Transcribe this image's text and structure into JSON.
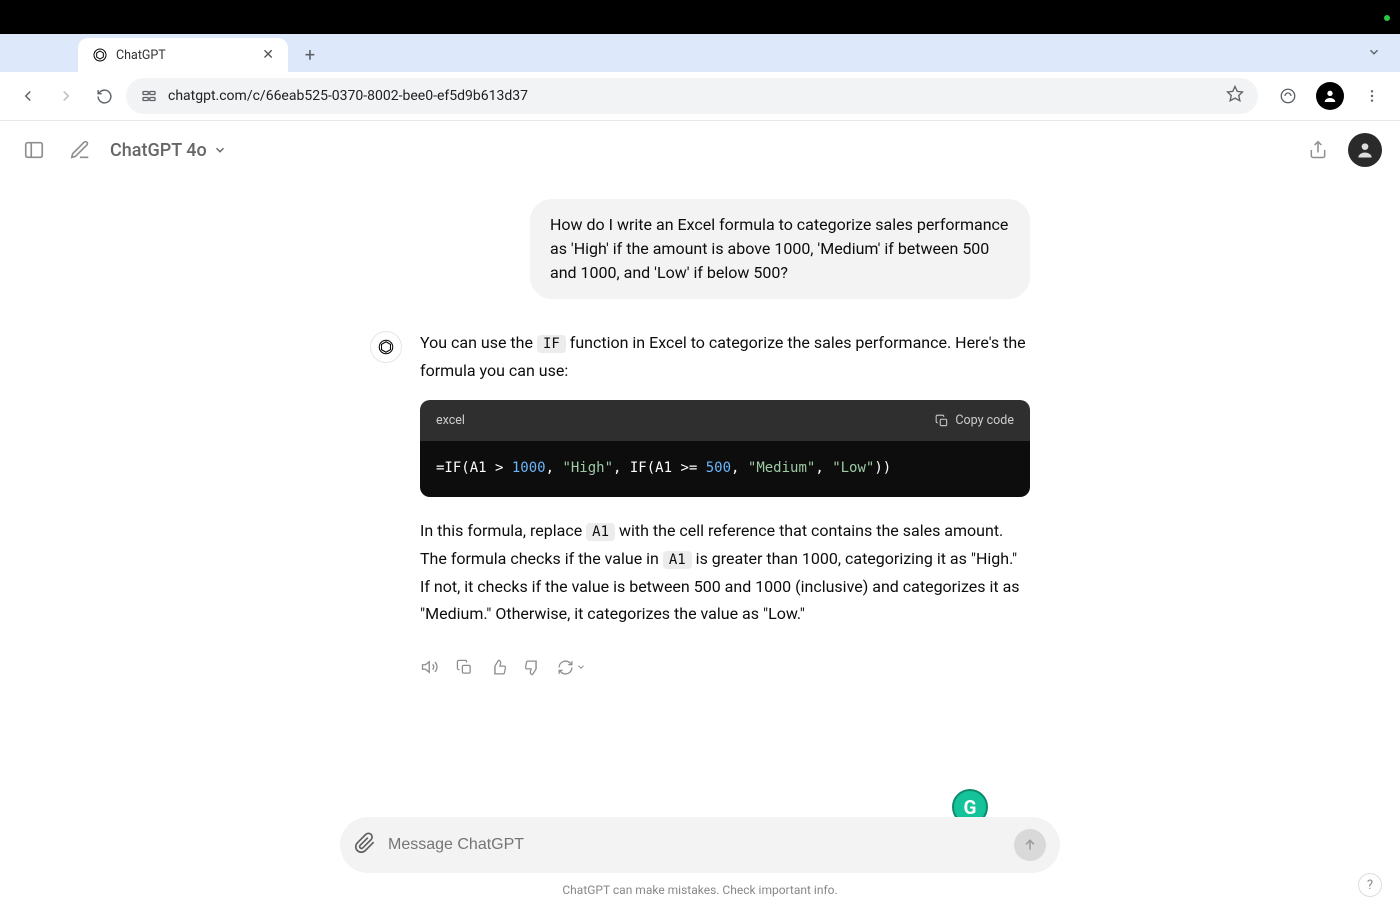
{
  "browser": {
    "tab_title": "ChatGPT",
    "url": "chatgpt.com/c/66eab525-0370-8002-bee0-ef5d9b613d37"
  },
  "header": {
    "model_name": "ChatGPT 4o"
  },
  "chat": {
    "user_message": "How do I write an Excel formula to categorize sales performance as 'High' if the amount is above 1000, 'Medium' if between 500 and 1000, and 'Low' if below 500?",
    "assistant_intro_pre": "You can use the ",
    "assistant_intro_code": "IF",
    "assistant_intro_post": " function in Excel to categorize the sales performance. Here's the formula you can use:",
    "code_lang": "excel",
    "copy_code_label": "Copy code",
    "code_formula_prefix": "=IF(A1 > ",
    "code_num1": "1000",
    "code_sep1": ", ",
    "code_str_high": "\"High\"",
    "code_sep2": ", IF(A1 >= ",
    "code_num2": "500",
    "code_sep3": ", ",
    "code_str_medium": "\"Medium\"",
    "code_sep4": ", ",
    "code_str_low": "\"Low\"",
    "code_suffix": "))",
    "assistant_expl_1a": "In this formula, replace ",
    "assistant_expl_1_code": "A1",
    "assistant_expl_1b": " with the cell reference that contains the sales amount. The formula checks if the value in ",
    "assistant_expl_1_code2": "A1",
    "assistant_expl_1c": " is greater than 1000, categorizing it as \"High.\" If not, it checks if the value is between 500 and 1000 (inclusive) and categorizes it as \"Medium.\" Otherwise, it categorizes the value as \"Low.\""
  },
  "composer": {
    "placeholder": "Message ChatGPT"
  },
  "footer": {
    "note": "ChatGPT can make mistakes. Check important info.",
    "help": "?"
  },
  "grammarly": {
    "letter": "G"
  }
}
